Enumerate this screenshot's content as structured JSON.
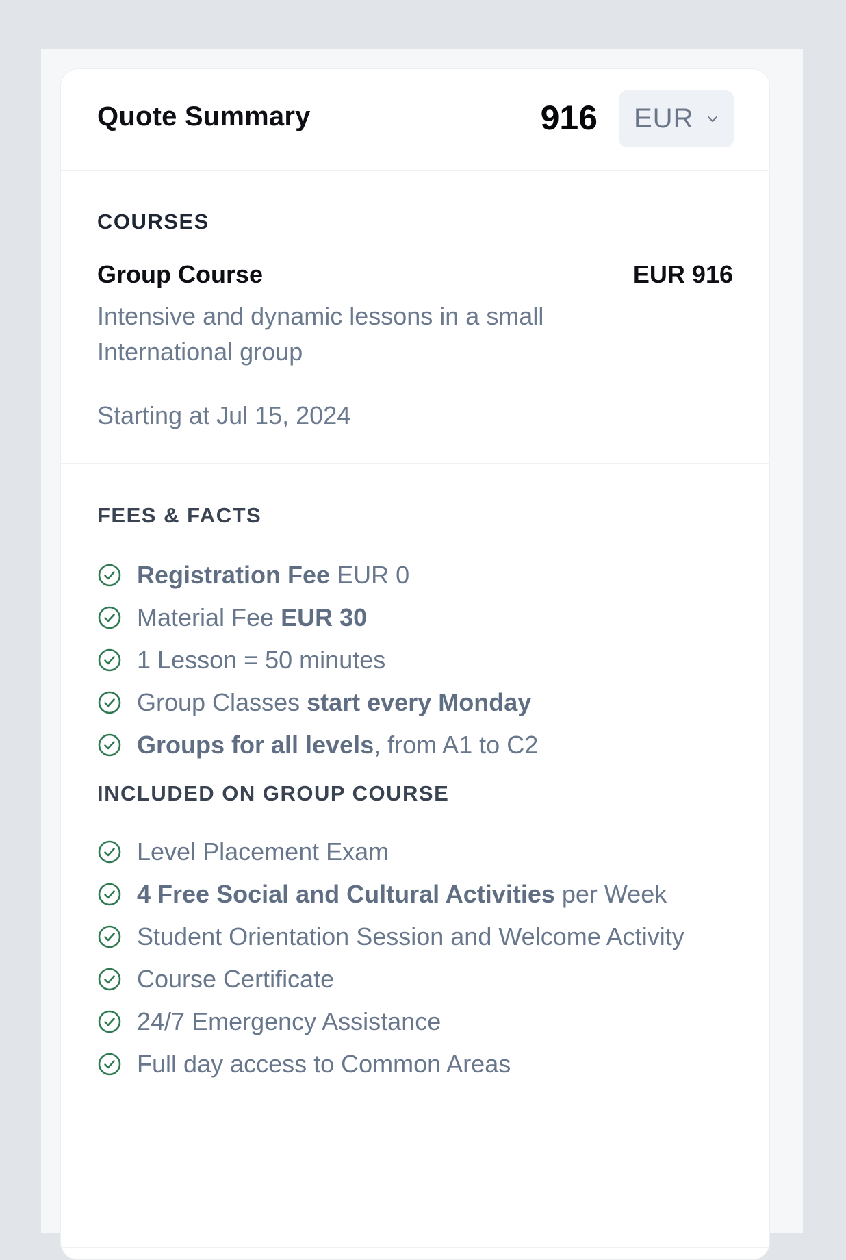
{
  "header": {
    "title": "Quote Summary",
    "total": "916",
    "currency": "EUR",
    "currency_icon": "chevron-down-icon"
  },
  "courses": {
    "section_title": "COURSES",
    "items": [
      {
        "name": "Group Course",
        "price": "EUR 916",
        "description": "Intensive and dynamic lessons in a small International group",
        "start": "Starting at Jul 15, 2024"
      }
    ]
  },
  "fees_facts": {
    "section_title": "FEES & FACTS",
    "items": [
      {
        "bold_part": "Registration Fee",
        "rest": " EUR 0"
      },
      {
        "plain_part": "Material Fee ",
        "bold_part": "EUR 30"
      },
      {
        "text": "1 Lesson = 50 minutes"
      },
      {
        "plain_part": "Group Classes ",
        "bold_part": "start every Monday"
      },
      {
        "bold_part": "Groups for all levels",
        "rest": ", from A1 to C2"
      }
    ]
  },
  "included": {
    "section_title": "INCLUDED ON GROUP COURSE",
    "items": [
      {
        "text": "Level Placement Exam"
      },
      {
        "bold_part": "4 Free Social and Cultural Activities",
        "rest": " per Week"
      },
      {
        "text": "Student Orientation Session and Welcome Activity"
      },
      {
        "text": "Course Certificate"
      },
      {
        "text": "24/7 Emergency Assistance"
      },
      {
        "text": "Full day access to Common Areas"
      }
    ]
  },
  "colors": {
    "check": "#2f7a52",
    "background": "#e1e4e9",
    "card": "#ffffff",
    "muted_text": "#68778c"
  }
}
